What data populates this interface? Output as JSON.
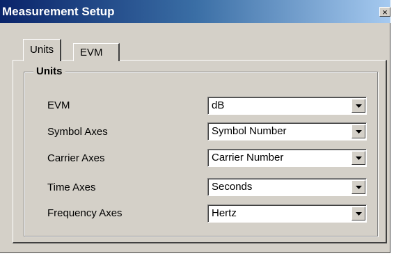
{
  "window": {
    "title": "Measurement Setup",
    "close_glyph": "×"
  },
  "tabs": [
    {
      "label": "Units",
      "selected": true
    },
    {
      "label": "EVM",
      "selected": false
    }
  ],
  "units_group": {
    "title": "Units",
    "rows": [
      {
        "label": "EVM",
        "value": "dB"
      },
      {
        "label": "Symbol Axes",
        "value": "Symbol Number"
      },
      {
        "label": "Carrier Axes",
        "value": "Carrier Number"
      },
      {
        "label": "Time Axes",
        "value": "Seconds"
      },
      {
        "label": "Frequency Axes",
        "value": "Hertz"
      }
    ]
  },
  "colors": {
    "titlebar_start": "#0a246a",
    "titlebar_end": "#a6caf0",
    "window_bg": "#d4d0c8"
  },
  "icons": {
    "dropdown": "chevron-down-icon",
    "close": "close-icon"
  }
}
